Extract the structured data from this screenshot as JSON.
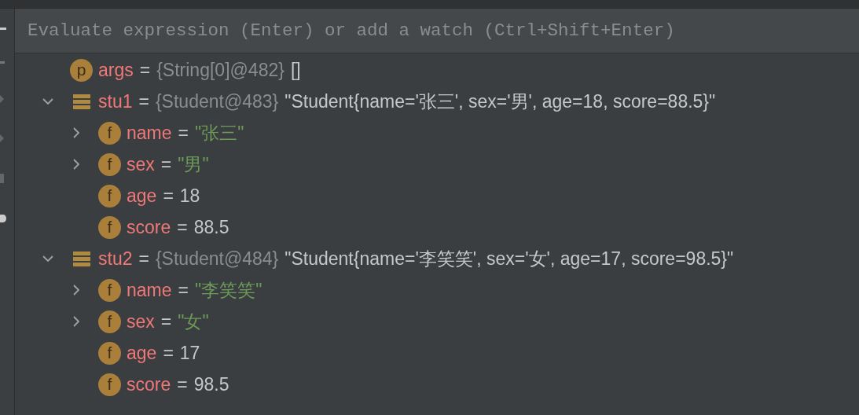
{
  "watch_field": {
    "placeholder": "Evaluate expression (Enter) or add a watch (Ctrl+Shift+Enter)"
  },
  "variables": [
    {
      "kind": "parameter",
      "badge": "p",
      "name": "args",
      "operator": "=",
      "type": "{String[0]@482}",
      "value": {
        "kind": "plain",
        "text": "[]"
      }
    },
    {
      "kind": "object",
      "name": "stu1",
      "operator": "=",
      "type": "{Student@483}",
      "value": {
        "kind": "plain",
        "text": "\"Student{name='张三', sex='男', age=18, score=88.5}\""
      },
      "expanded": true,
      "children": [
        {
          "kind": "field",
          "badge": "f",
          "name": "name",
          "operator": "=",
          "value": {
            "kind": "string",
            "text": "\"张三\""
          },
          "expanded": false
        },
        {
          "kind": "field",
          "badge": "f",
          "name": "sex",
          "operator": "=",
          "value": {
            "kind": "string",
            "text": "\"男\""
          },
          "expanded": false
        },
        {
          "kind": "field",
          "badge": "f",
          "name": "age",
          "operator": "=",
          "value": {
            "kind": "plain",
            "text": "18"
          }
        },
        {
          "kind": "field",
          "badge": "f",
          "name": "score",
          "operator": "=",
          "value": {
            "kind": "plain",
            "text": "88.5"
          }
        }
      ]
    },
    {
      "kind": "object",
      "name": "stu2",
      "operator": "=",
      "type": "{Student@484}",
      "value": {
        "kind": "plain",
        "text": "\"Student{name='李笑笑', sex='女', age=17, score=98.5}\""
      },
      "expanded": true,
      "children": [
        {
          "kind": "field",
          "badge": "f",
          "name": "name",
          "operator": "=",
          "value": {
            "kind": "string",
            "text": "\"李笑笑\""
          },
          "expanded": false
        },
        {
          "kind": "field",
          "badge": "f",
          "name": "sex",
          "operator": "=",
          "value": {
            "kind": "string",
            "text": "\"女\""
          },
          "expanded": false
        },
        {
          "kind": "field",
          "badge": "f",
          "name": "age",
          "operator": "=",
          "value": {
            "kind": "plain",
            "text": "17"
          }
        },
        {
          "kind": "field",
          "badge": "f",
          "name": "score",
          "operator": "=",
          "value": {
            "kind": "plain",
            "text": "98.5"
          }
        }
      ]
    }
  ]
}
